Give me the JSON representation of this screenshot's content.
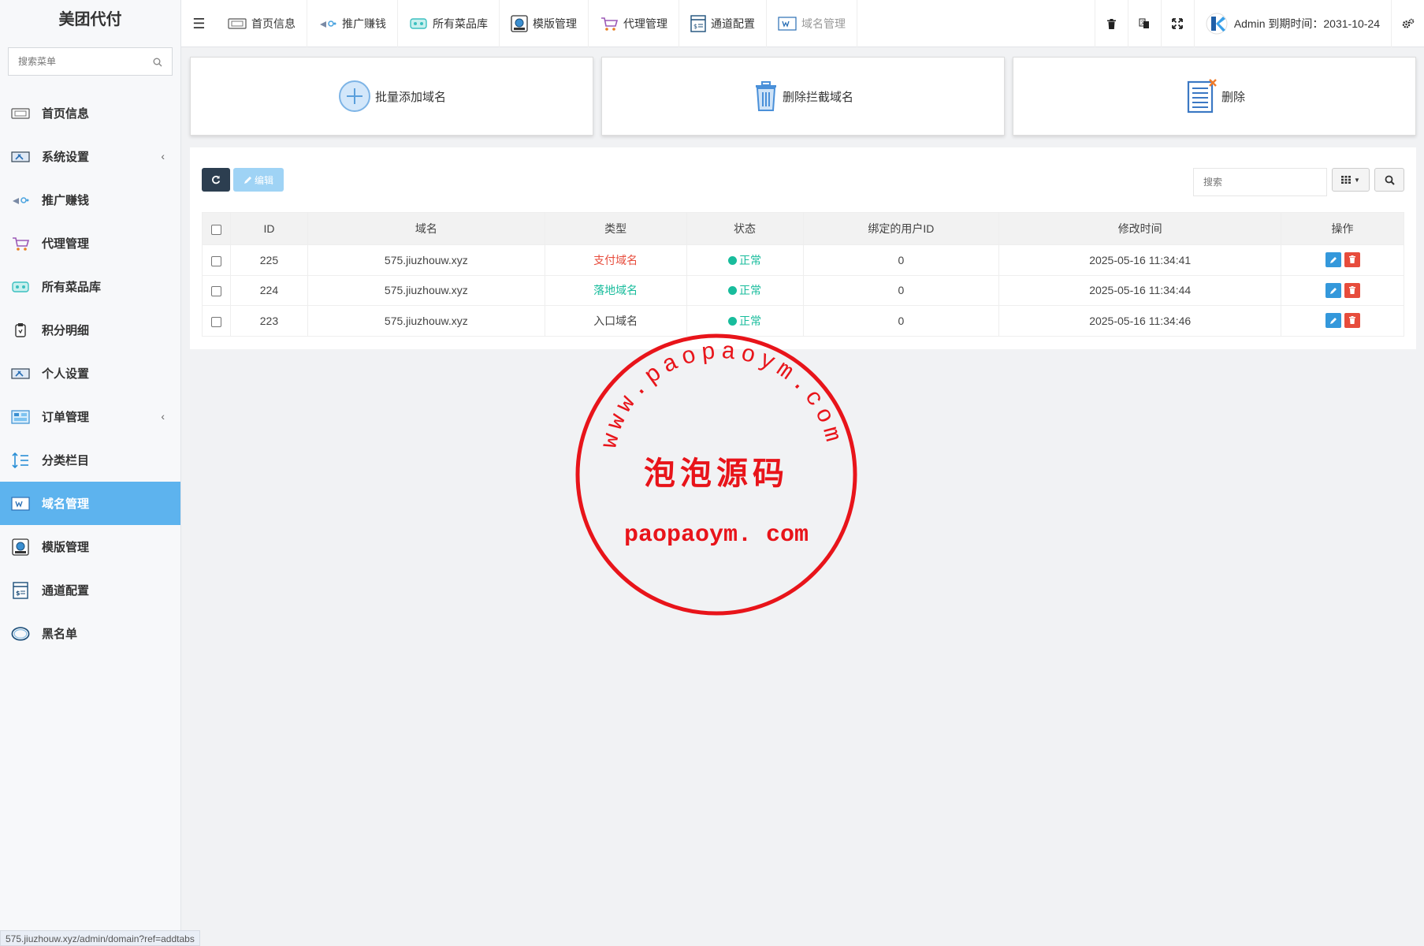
{
  "app": {
    "brand": "美团代付"
  },
  "sidebar": {
    "search_placeholder": "搜索菜单",
    "items": [
      {
        "label": "首页信息",
        "icon": "dashboard-icon",
        "submenu": false
      },
      {
        "label": "系统设置",
        "icon": "settings-icon",
        "submenu": true
      },
      {
        "label": "推广赚钱",
        "icon": "promo-icon",
        "submenu": false
      },
      {
        "label": "代理管理",
        "icon": "cart-icon",
        "submenu": false
      },
      {
        "label": "所有菜品库",
        "icon": "dishes-icon",
        "submenu": false
      },
      {
        "label": "积分明细",
        "icon": "points-icon",
        "submenu": false
      },
      {
        "label": "个人设置",
        "icon": "profile-icon",
        "submenu": false
      },
      {
        "label": "订单管理",
        "icon": "orders-icon",
        "submenu": true
      },
      {
        "label": "分类栏目",
        "icon": "sort-icon",
        "submenu": false
      },
      {
        "label": "域名管理",
        "icon": "domain-icon",
        "submenu": false,
        "active": true
      },
      {
        "label": "模版管理",
        "icon": "template-icon",
        "submenu": false
      },
      {
        "label": "通道配置",
        "icon": "channel-icon",
        "submenu": false
      },
      {
        "label": "黑名单",
        "icon": "blacklist-icon",
        "submenu": false
      }
    ]
  },
  "topbar": {
    "tabs": [
      {
        "label": "首页信息",
        "icon": "dashboard-icon"
      },
      {
        "label": "推广赚钱",
        "icon": "promo-icon"
      },
      {
        "label": "所有菜品库",
        "icon": "dishes-icon"
      },
      {
        "label": "模版管理",
        "icon": "template-icon"
      },
      {
        "label": "代理管理",
        "icon": "cart-icon"
      },
      {
        "label": "通道配置",
        "icon": "channel-icon"
      },
      {
        "label": "域名管理",
        "icon": "domain-icon",
        "current": true
      }
    ],
    "user_text": "Admin 到期时间：2031-10-24"
  },
  "actions": {
    "batch_add": "批量添加域名",
    "delete_blocked": "删除拦截域名",
    "delete": "删除"
  },
  "toolbar": {
    "edit_label": "编辑",
    "search_placeholder": "搜索"
  },
  "table": {
    "columns": [
      "ID",
      "域名",
      "类型",
      "状态",
      "绑定的用户ID",
      "修改时间",
      "操作"
    ],
    "rows": [
      {
        "id": "225",
        "domain": "575.jiuzhouw.xyz",
        "type": "支付域名",
        "type_color": "#e74c3c",
        "status": "正常",
        "user_id": "0",
        "modified": "2025-05-16 11:34:41"
      },
      {
        "id": "224",
        "domain": "575.jiuzhouw.xyz",
        "type": "落地域名",
        "type_color": "#18bc9c",
        "status": "正常",
        "user_id": "0",
        "modified": "2025-05-16 11:34:44"
      },
      {
        "id": "223",
        "domain": "575.jiuzhouw.xyz",
        "type": "入口域名",
        "type_color": "#444444",
        "status": "正常",
        "user_id": "0",
        "modified": "2025-05-16 11:34:46"
      }
    ]
  },
  "status_bar": {
    "url": "575.jiuzhouw.xyz/admin/domain?ref=addtabs"
  },
  "watermark": {
    "arc_text": "www.paopaoym.com",
    "center_text": "泡泡源码",
    "bottom_text": "paopaoym. com"
  },
  "colors": {
    "accent": "#5db3ee",
    "status_ok": "#18bc9c",
    "danger": "#e74c3c",
    "edit": "#3498db",
    "dark_button": "#2c3e50",
    "stamp": "#e8141a"
  }
}
